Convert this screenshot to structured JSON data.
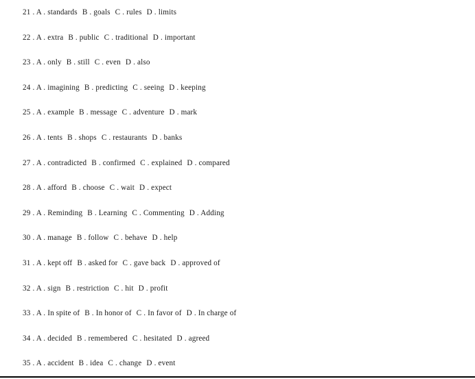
{
  "document": {
    "type": "multiple-choice-answer-options-sheet",
    "separator": " . ",
    "footer_rule_color": "#000000",
    "background_color": "#ffffff",
    "text_color": "#1b1b1b"
  },
  "questions": [
    {
      "number": "21",
      "options": [
        {
          "letter": "A",
          "text": "standards"
        },
        {
          "letter": "B",
          "text": "goals"
        },
        {
          "letter": "C",
          "text": "rules"
        },
        {
          "letter": "D",
          "text": "limits"
        }
      ]
    },
    {
      "number": "22",
      "options": [
        {
          "letter": "A",
          "text": "extra"
        },
        {
          "letter": "B",
          "text": "public"
        },
        {
          "letter": "C",
          "text": "traditional"
        },
        {
          "letter": "D",
          "text": "important"
        }
      ]
    },
    {
      "number": "23",
      "options": [
        {
          "letter": "A",
          "text": "only"
        },
        {
          "letter": "B",
          "text": "still"
        },
        {
          "letter": "C",
          "text": "even"
        },
        {
          "letter": "D",
          "text": "also"
        }
      ]
    },
    {
      "number": "24",
      "options": [
        {
          "letter": "A",
          "text": "imagining"
        },
        {
          "letter": "B",
          "text": "predicting"
        },
        {
          "letter": "C",
          "text": "seeing"
        },
        {
          "letter": "D",
          "text": "keeping"
        }
      ]
    },
    {
      "number": "25",
      "options": [
        {
          "letter": "A",
          "text": "example"
        },
        {
          "letter": "B",
          "text": "message"
        },
        {
          "letter": "C",
          "text": "adventure"
        },
        {
          "letter": "D",
          "text": "mark"
        }
      ]
    },
    {
      "number": "26",
      "options": [
        {
          "letter": "A",
          "text": "tents"
        },
        {
          "letter": "B",
          "text": "shops"
        },
        {
          "letter": "C",
          "text": "restaurants"
        },
        {
          "letter": "D",
          "text": "banks"
        }
      ]
    },
    {
      "number": "27",
      "options": [
        {
          "letter": "A",
          "text": "contradicted"
        },
        {
          "letter": "B",
          "text": "confirmed"
        },
        {
          "letter": "C",
          "text": "explained"
        },
        {
          "letter": "D",
          "text": "compared"
        }
      ]
    },
    {
      "number": "28",
      "options": [
        {
          "letter": "A",
          "text": "afford"
        },
        {
          "letter": "B",
          "text": "choose"
        },
        {
          "letter": "C",
          "text": "wait"
        },
        {
          "letter": "D",
          "text": "expect"
        }
      ]
    },
    {
      "number": "29",
      "options": [
        {
          "letter": "A",
          "text": "Reminding"
        },
        {
          "letter": "B",
          "text": "Learning"
        },
        {
          "letter": "C",
          "text": "Commenting"
        },
        {
          "letter": "D",
          "text": "Adding"
        }
      ]
    },
    {
      "number": "30",
      "options": [
        {
          "letter": "A",
          "text": "manage"
        },
        {
          "letter": "B",
          "text": "follow"
        },
        {
          "letter": "C",
          "text": "behave"
        },
        {
          "letter": "D",
          "text": "help"
        }
      ]
    },
    {
      "number": "31",
      "options": [
        {
          "letter": "A",
          "text": "kept off"
        },
        {
          "letter": "B",
          "text": "asked for"
        },
        {
          "letter": "C",
          "text": "gave back"
        },
        {
          "letter": "D",
          "text": "approved of"
        }
      ]
    },
    {
      "number": "32",
      "options": [
        {
          "letter": "A",
          "text": "sign"
        },
        {
          "letter": "B",
          "text": "restriction"
        },
        {
          "letter": "C",
          "text": "hit"
        },
        {
          "letter": "D",
          "text": "profit"
        }
      ]
    },
    {
      "number": "33",
      "options": [
        {
          "letter": "A",
          "text": "In spite of"
        },
        {
          "letter": "B",
          "text": "In honor of"
        },
        {
          "letter": "C",
          "text": "In favor of"
        },
        {
          "letter": "D",
          "text": "In charge of"
        }
      ]
    },
    {
      "number": "34",
      "options": [
        {
          "letter": "A",
          "text": "decided"
        },
        {
          "letter": "B",
          "text": "remembered"
        },
        {
          "letter": "C",
          "text": "hesitated"
        },
        {
          "letter": "D",
          "text": "agreed"
        }
      ]
    },
    {
      "number": "35",
      "options": [
        {
          "letter": "A",
          "text": "accident"
        },
        {
          "letter": "B",
          "text": "idea"
        },
        {
          "letter": "C",
          "text": "change"
        },
        {
          "letter": "D",
          "text": "event"
        }
      ]
    }
  ]
}
